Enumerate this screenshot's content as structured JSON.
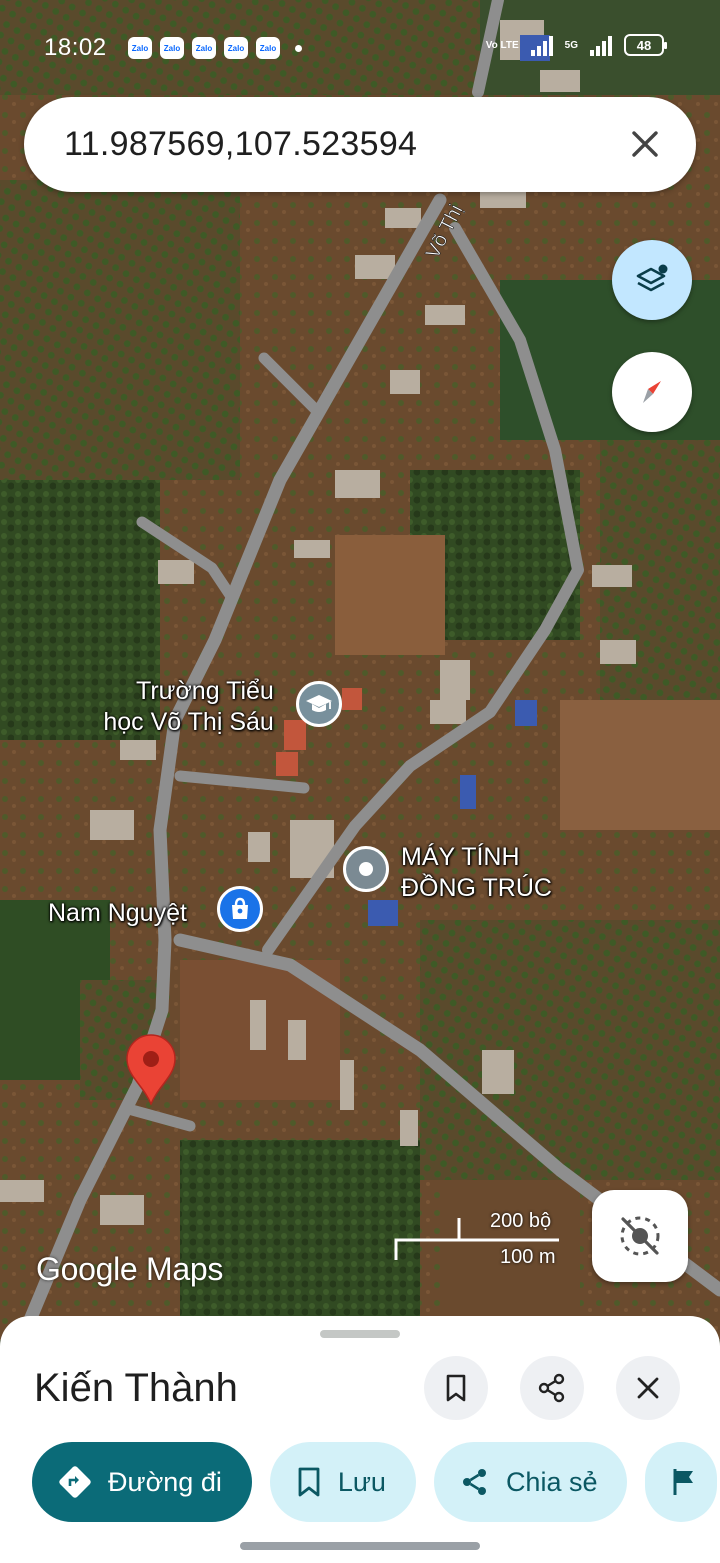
{
  "status_bar": {
    "time": "18:02",
    "notification_apps": [
      "Zalo",
      "Zalo",
      "Zalo",
      "Zalo",
      "Zalo"
    ],
    "network_primary": "Vo LTE",
    "network_secondary": "5G",
    "battery": "48"
  },
  "search": {
    "value": "11.987569,107.523594"
  },
  "map": {
    "road_label": "Võ Thị",
    "pois": [
      {
        "label_line1": "Trường Tiểu",
        "label_line2": "học Võ Thị Sáu",
        "icon": "graduation-cap-icon",
        "color": "#78909c"
      },
      {
        "label_line1": "MÁY TÍNH",
        "label_line2": "ĐỒNG TRÚC",
        "icon": "place-dot-icon",
        "color": "#7b8a93"
      },
      {
        "label_line1": "Nam Nguyệt",
        "icon": "shopping-bag-icon",
        "color": "#1a73e8"
      }
    ],
    "pin_color": "#ea4335",
    "scale_imperial": "200 bộ",
    "scale_metric": "100 m",
    "logo_text": "Google Maps"
  },
  "place": {
    "title": "Kiến Thành"
  },
  "actions": {
    "directions": "Đường đi",
    "save": "Lưu",
    "share": "Chia sẻ"
  },
  "colors": {
    "accent": "#0b6b78",
    "chip_bg": "#d3f1f8",
    "fab_layers": "#c2e7ff"
  }
}
